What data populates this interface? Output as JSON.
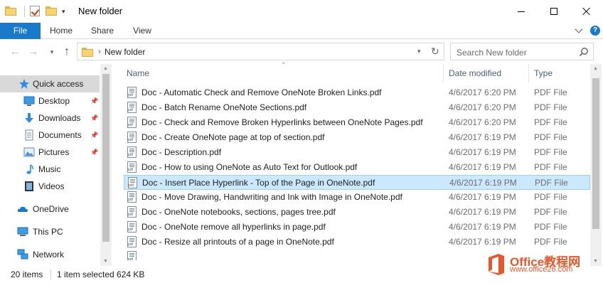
{
  "window": {
    "title": "New folder",
    "quick_access_toolbar": [
      "folder-icon",
      "properties-icon",
      "new-folder-icon",
      "customize-dropdown-icon"
    ],
    "controls": [
      "minimize",
      "maximize",
      "close"
    ]
  },
  "ribbon": {
    "tabs": [
      {
        "label": "File",
        "active": true
      },
      {
        "label": "Home"
      },
      {
        "label": "Share"
      },
      {
        "label": "View"
      }
    ],
    "accent_color": "#1979ca"
  },
  "address_bar": {
    "path": "New folder",
    "search_placeholder": "Search New folder"
  },
  "navigation_pane": {
    "items": [
      {
        "label": "Quick access",
        "icon": "star-icon",
        "selected": true
      },
      {
        "label": "Desktop",
        "icon": "desktop-icon",
        "pinned": true
      },
      {
        "label": "Downloads",
        "icon": "download-icon",
        "pinned": true
      },
      {
        "label": "Documents",
        "icon": "documents-icon",
        "pinned": true
      },
      {
        "label": "Pictures",
        "icon": "pictures-icon",
        "pinned": true
      },
      {
        "label": "Music",
        "icon": "music-icon"
      },
      {
        "label": "Videos",
        "icon": "videos-icon"
      },
      {
        "label": "OneDrive",
        "icon": "onedrive-icon"
      },
      {
        "label": "This PC",
        "icon": "this-pc-icon"
      },
      {
        "label": "Network",
        "icon": "network-icon"
      }
    ]
  },
  "file_list": {
    "columns": [
      "Name",
      "Date modified",
      "Type"
    ],
    "files": [
      {
        "name": "Doc - Automatic Check and Remove OneNote Broken Links.pdf",
        "date": "4/6/2017 6:20 PM",
        "type": "PDF File"
      },
      {
        "name": "Doc - Batch Rename OneNote Sections.pdf",
        "date": "4/6/2017 6:20 PM",
        "type": "PDF File"
      },
      {
        "name": "Doc - Check and Remove Broken Hyperlinks between OneNote Pages.pdf",
        "date": "4/6/2017 6:20 PM",
        "type": "PDF File"
      },
      {
        "name": "Doc - Create OneNote page at top of section.pdf",
        "date": "4/6/2017 6:19 PM",
        "type": "PDF File"
      },
      {
        "name": "Doc - Description.pdf",
        "date": "4/6/2017 6:19 PM",
        "type": "PDF File"
      },
      {
        "name": "Doc - How to using OneNote as Auto Text for Outlook.pdf",
        "date": "4/6/2017 6:19 PM",
        "type": "PDF File"
      },
      {
        "name": "Doc - Insert Place Hyperlink - Top of the Page in OneNote.pdf",
        "date": "4/6/2017 6:19 PM",
        "type": "PDF File",
        "selected": true
      },
      {
        "name": "Doc - Move Drawing, Handwriting and Ink with Image in OneNote.pdf",
        "date": "4/6/2017 6:19 PM",
        "type": "PDF File"
      },
      {
        "name": "Doc - OneNote notebooks, sections, pages tree.pdf",
        "date": "4/6/2017 6:19 PM",
        "type": "PDF File"
      },
      {
        "name": "Doc - OneNote remove all hyperlinks in page.pdf",
        "date": "4/6/2017 6:19 PM",
        "type": "PDF File"
      },
      {
        "name": "Doc - Resize all printouts of a page in OneNote.pdf",
        "date": "4/6/2017 6:19 PM",
        "type": "PDF File"
      }
    ],
    "selection_color": "#cce8ff"
  },
  "status_bar": {
    "item_count": "20 items",
    "selection": "1 item selected",
    "size": "624 KB"
  },
  "watermark": {
    "brand": "Office教程网",
    "url": "www.office26.com"
  }
}
